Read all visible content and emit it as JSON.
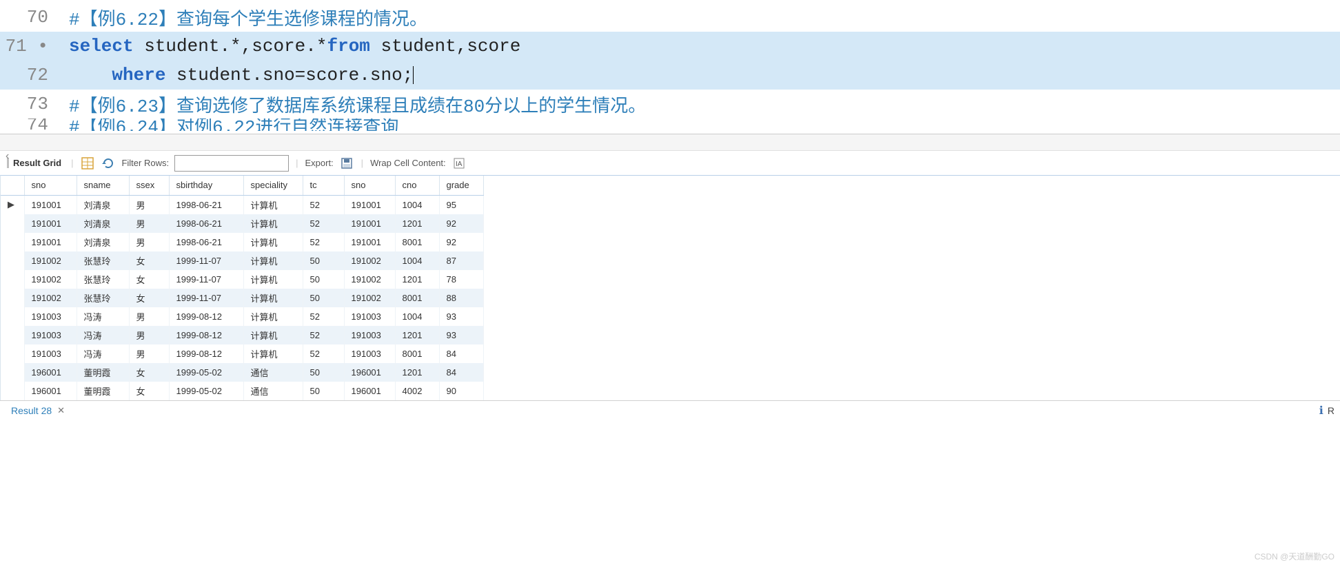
{
  "editor": {
    "lines": [
      {
        "num": "70",
        "marker": "",
        "segments": [
          {
            "cls": "comment",
            "t": "#【例6.22】查询每个学生选修课程的情况。"
          }
        ],
        "hl": false
      },
      {
        "num": "71",
        "marker": "•",
        "segments": [
          {
            "cls": "keyword",
            "t": "select"
          },
          {
            "cls": "plain",
            "t": " student.*,score.*"
          },
          {
            "cls": "keyword",
            "t": "from"
          },
          {
            "cls": "plain",
            "t": " student,score"
          }
        ],
        "hl": true
      },
      {
        "num": "72",
        "marker": "",
        "segments": [
          {
            "cls": "plain",
            "t": "    "
          },
          {
            "cls": "keyword",
            "t": "where"
          },
          {
            "cls": "plain",
            "t": " student.sno=score.sno;"
          }
        ],
        "hl": true,
        "cursor": true
      },
      {
        "num": "73",
        "marker": "",
        "segments": [
          {
            "cls": "comment",
            "t": "#【例6.23】查询选修了数据库系统课程且成绩在80分以上的学生情况。"
          }
        ],
        "hl": false
      },
      {
        "num": "74",
        "marker": "",
        "segments": [
          {
            "cls": "comment",
            "t": "#【例6.24】对例6.22进行自然连接查询"
          }
        ],
        "hl": false,
        "partial": true
      }
    ]
  },
  "toolbar": {
    "result_grid": "Result Grid",
    "filter_label": "Filter Rows:",
    "filter_value": "",
    "export_label": "Export:",
    "wrap_label": "Wrap Cell Content:"
  },
  "table": {
    "headers": [
      "sno",
      "sname",
      "ssex",
      "sbirthday",
      "speciality",
      "tc",
      "sno",
      "cno",
      "grade"
    ],
    "rows": [
      [
        "191001",
        "刘清泉",
        "男",
        "1998-06-21",
        "计算机",
        "52",
        "191001",
        "1004",
        "95"
      ],
      [
        "191001",
        "刘清泉",
        "男",
        "1998-06-21",
        "计算机",
        "52",
        "191001",
        "1201",
        "92"
      ],
      [
        "191001",
        "刘清泉",
        "男",
        "1998-06-21",
        "计算机",
        "52",
        "191001",
        "8001",
        "92"
      ],
      [
        "191002",
        "张慧玲",
        "女",
        "1999-11-07",
        "计算机",
        "50",
        "191002",
        "1004",
        "87"
      ],
      [
        "191002",
        "张慧玲",
        "女",
        "1999-11-07",
        "计算机",
        "50",
        "191002",
        "1201",
        "78"
      ],
      [
        "191002",
        "张慧玲",
        "女",
        "1999-11-07",
        "计算机",
        "50",
        "191002",
        "8001",
        "88"
      ],
      [
        "191003",
        "冯涛",
        "男",
        "1999-08-12",
        "计算机",
        "52",
        "191003",
        "1004",
        "93"
      ],
      [
        "191003",
        "冯涛",
        "男",
        "1999-08-12",
        "计算机",
        "52",
        "191003",
        "1201",
        "93"
      ],
      [
        "191003",
        "冯涛",
        "男",
        "1999-08-12",
        "计算机",
        "52",
        "191003",
        "8001",
        "84"
      ],
      [
        "196001",
        "董明霞",
        "女",
        "1999-05-02",
        "通信",
        "50",
        "196001",
        "1201",
        "84"
      ],
      [
        "196001",
        "董明霞",
        "女",
        "1999-05-02",
        "通信",
        "50",
        "196001",
        "4002",
        "90"
      ]
    ],
    "active_row": 0
  },
  "tabs": {
    "result_tab": "Result 28",
    "readonly": "R"
  },
  "watermark": "CSDN @天道酬勤GO"
}
